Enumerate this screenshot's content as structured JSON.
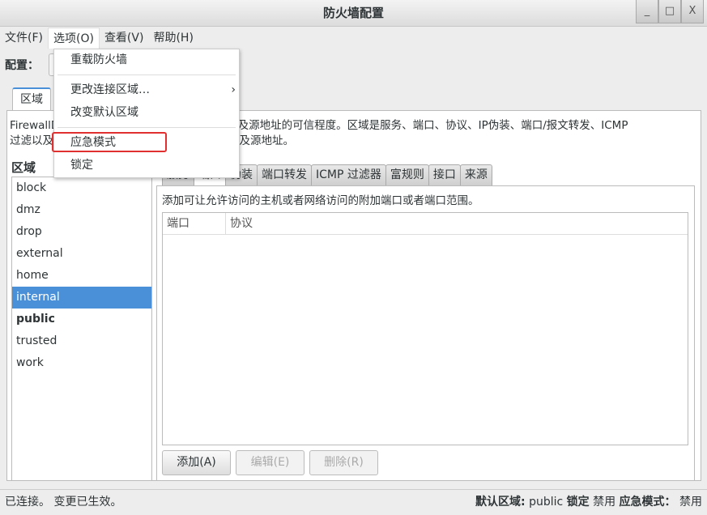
{
  "window": {
    "title": "防火墙配置",
    "minimize": "_",
    "maximize": "□",
    "close": "X"
  },
  "menubar": [
    "文件(F)",
    "选项(O)",
    "查看(V)",
    "帮助(H)"
  ],
  "config_label": "配置：",
  "outer_tab": "区域",
  "description": {
    "line1": "FirewallD 区域定义了绑定的网络连接、接口以及源地址的可信程度。区域是服务、端口、协议、IP伪装、端口/报文转发、ICMP",
    "line2": "过滤以及富规则的组合。区域可以绑定到接口以及源地址。"
  },
  "zones_label": "区域",
  "zones": [
    {
      "name": "block"
    },
    {
      "name": "dmz"
    },
    {
      "name": "drop"
    },
    {
      "name": "external"
    },
    {
      "name": "home"
    },
    {
      "name": "internal",
      "selected": true
    },
    {
      "name": "public",
      "bold": true
    },
    {
      "name": "trusted"
    },
    {
      "name": "work"
    }
  ],
  "inner_tabs": [
    "服务",
    "端口",
    "伪装",
    "端口转发",
    "ICMP 过滤器",
    "富规则",
    "接口",
    "来源"
  ],
  "active_inner_tab": "端口",
  "ports": {
    "hint": "添加可让允许访问的主机或者网络访问的附加端口或者端口范围。",
    "columns": [
      "端口",
      "协议"
    ],
    "rows": []
  },
  "buttons": {
    "add": "添加(A)",
    "edit": "编辑(E)",
    "remove": "删除(R)"
  },
  "status": {
    "left": "已连接。 变更已生效。",
    "default_zone_label": "默认区域:",
    "default_zone": "public",
    "lock_label": "锁定",
    "lock": "禁用",
    "panic_label": "应急模式：",
    "panic": "禁用"
  },
  "options_menu": {
    "items": [
      "重载防火墙",
      "更改连接区域…",
      "改变默认区域",
      "应急模式",
      "锁定"
    ],
    "highlighted": "应急模式",
    "highlight_color": "#e03030"
  }
}
